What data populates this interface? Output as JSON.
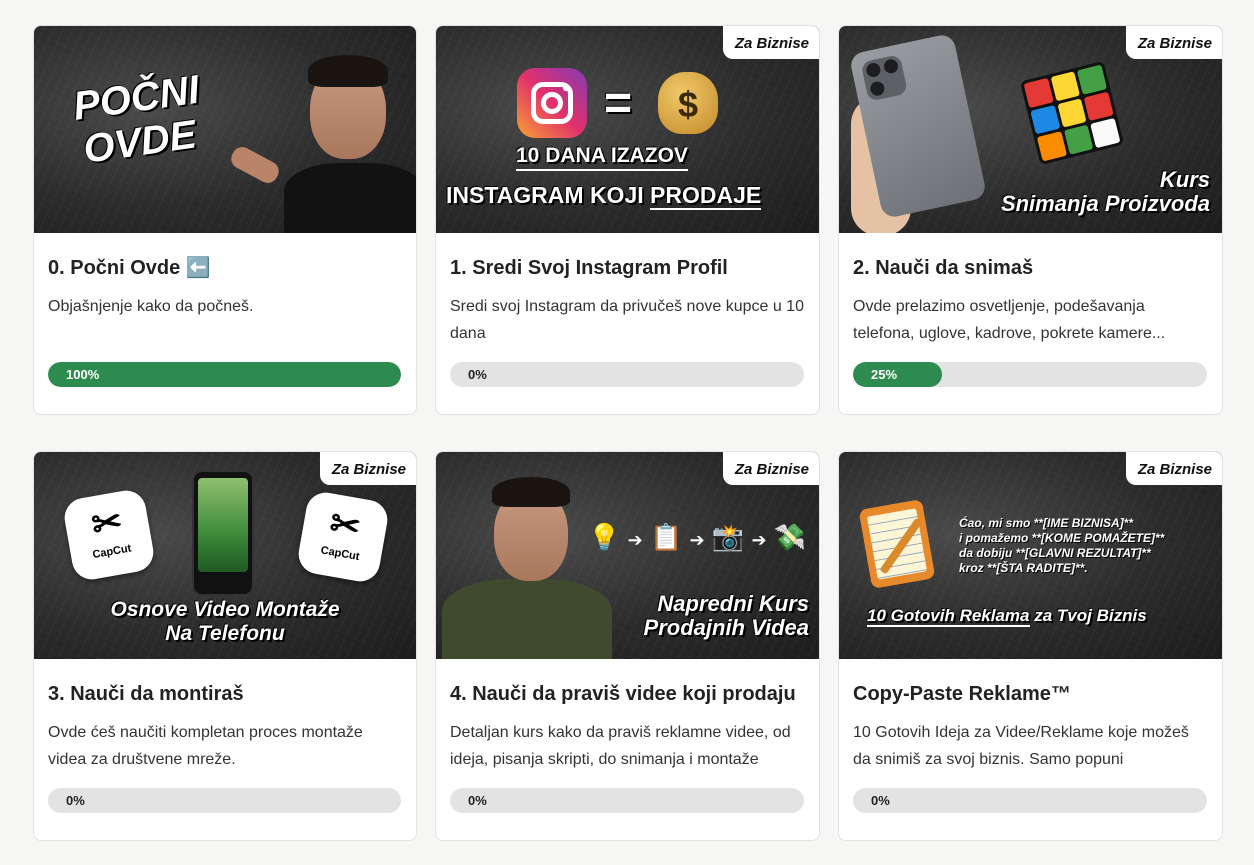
{
  "cards": [
    {
      "title": "0. Počni Ovde ⬅️",
      "description": "Objašnjenje kako da počneš.",
      "progress": 100,
      "progress_label": "100%",
      "thumb_text": [
        "POČNI",
        "OVDE"
      ]
    },
    {
      "title": "1. Sredi Svoj Instagram Profil",
      "description": "Sredi svoj Instagram da privučeš nove kupce u 10 dana",
      "progress": 0,
      "progress_label": "0%",
      "badge": "Za Biznise",
      "thumb_text": [
        "=",
        "$",
        "10 DANA IZAZOV",
        "INSTAGRAM KOJI",
        "PRODAJE"
      ]
    },
    {
      "title": "2. Nauči da snimaš",
      "description": "Ovde prelazimo osvetljenje, podešavanja telefona, uglove, kadrove, pokrete kamere...",
      "progress": 25,
      "progress_label": "25%",
      "badge": "Za Biznise",
      "thumb_text": [
        "Kurs",
        "Snimanja Proizvoda"
      ]
    },
    {
      "title": "3. Nauči da montiraš",
      "description": "Ovde ćeš naučiti kompletan proces montaže videa za društvene mreže.",
      "progress": 0,
      "progress_label": "0%",
      "badge": "Za Biznise",
      "thumb_text": [
        "CapCut",
        "CapCut",
        "Osnove Video Montaže",
        "Na Telefonu"
      ]
    },
    {
      "title": "4. Nauči da praviš videe koji prodaju",
      "description": "Detaljan kurs kako da praviš reklamne videe, od ideja, pisanja skripti, do snimanja i montaže",
      "progress": 0,
      "progress_label": "0%",
      "badge": "Za Biznise",
      "thumb_text": [
        "Napredni Kurs",
        "Prodajnih Videa"
      ]
    },
    {
      "title": "Copy-Paste Reklame™",
      "description": "10 Gotovih Ideja za Videe/Reklame koje možeš da snimiš za svoj biznis. Samo popuni",
      "progress": 0,
      "progress_label": "0%",
      "badge": "Za Biznise",
      "thumb_text": [
        "Ćao, mi smo **[IME BIZNISA]**",
        "i pomažemo **[KOME POMAŽETE]**",
        "da dobiju **[GLAVNI REZULTAT]**",
        "kroz **[ŠTA RADITE]**.",
        "10 Gotovih Reklama",
        "za Tvoj Biznis"
      ]
    }
  ],
  "colors": {
    "progress_fill": "#2e8b50",
    "progress_track": "#e3e3e3",
    "page_bg": "#f6f6f5"
  }
}
